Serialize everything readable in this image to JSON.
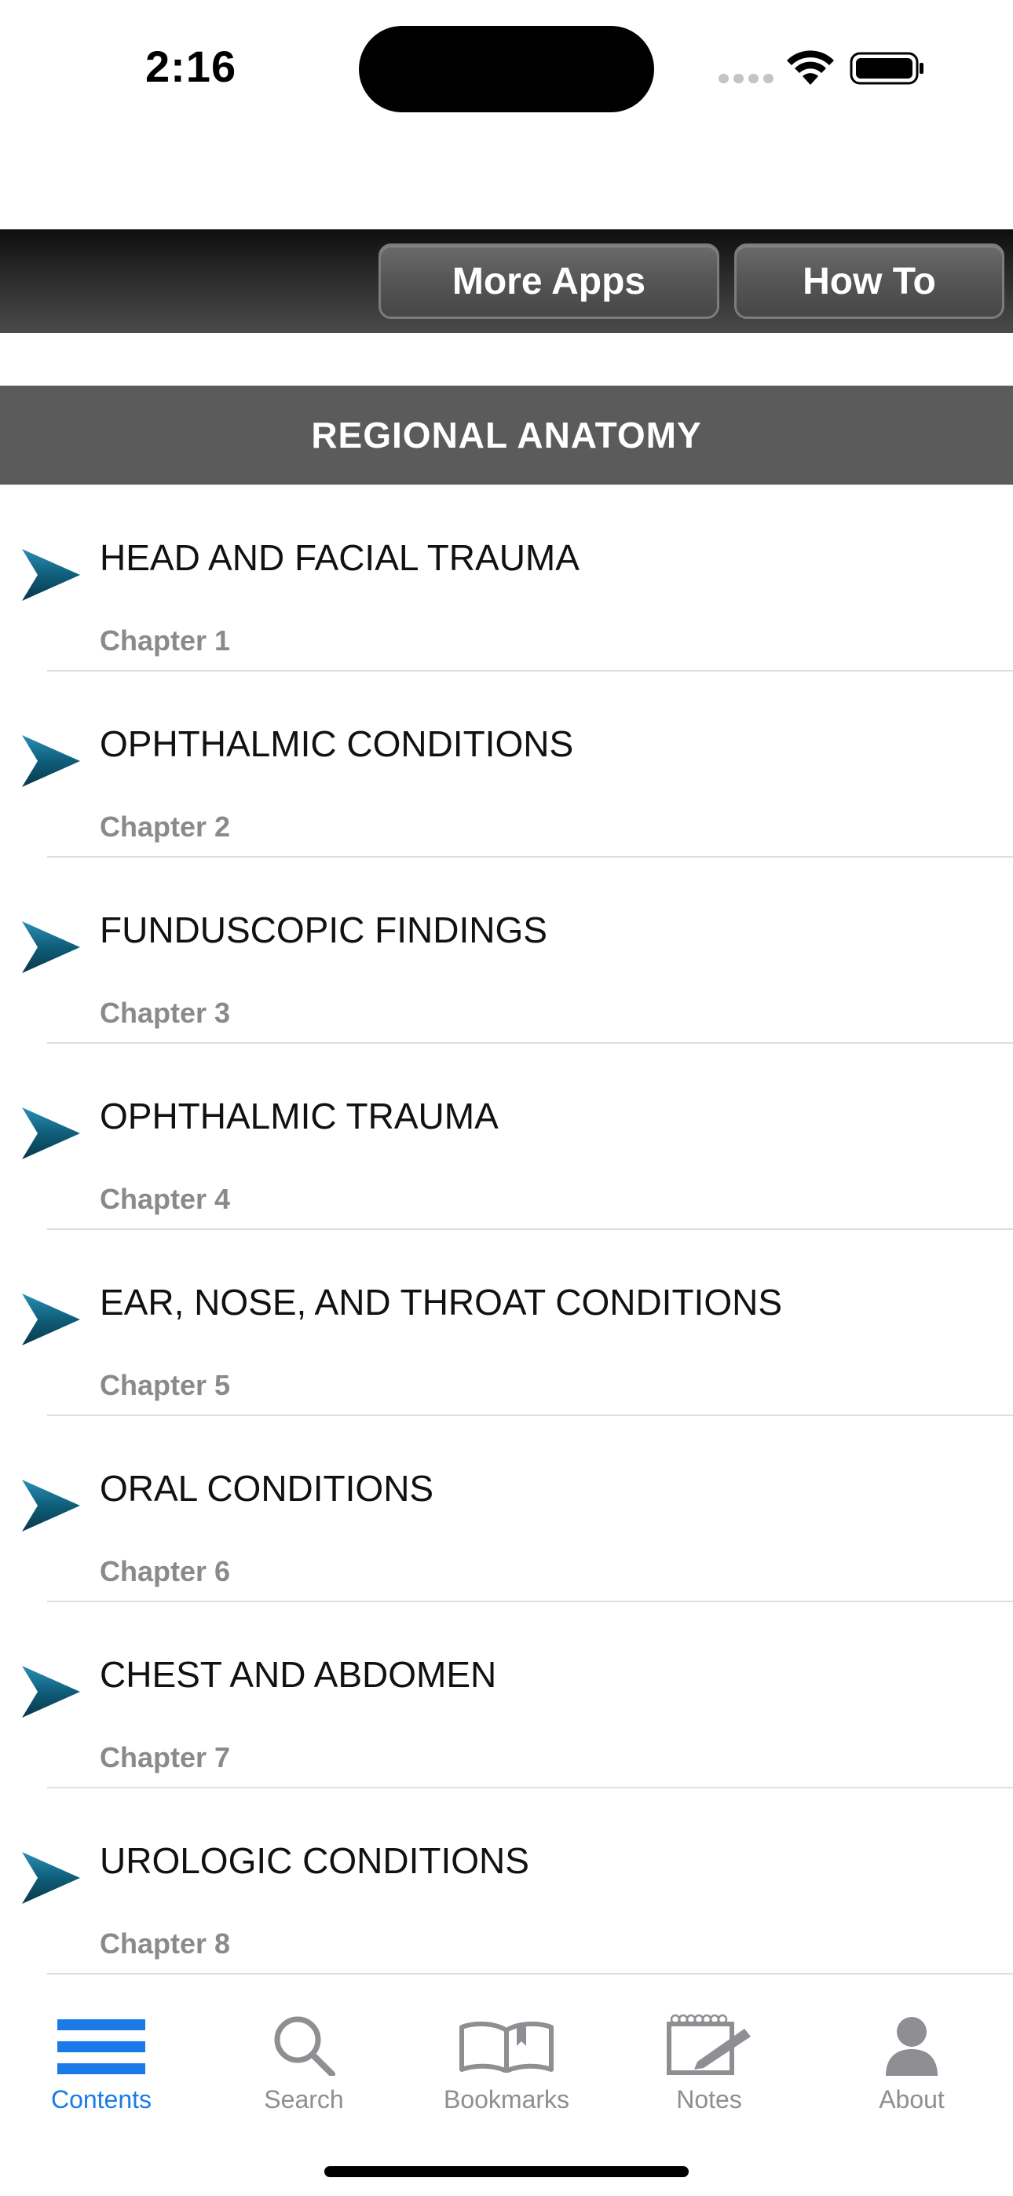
{
  "status_bar": {
    "time": "2:16"
  },
  "toolbar": {
    "more_apps_label": "More Apps",
    "how_to_label": "How To"
  },
  "section": {
    "title": "REGIONAL ANATOMY"
  },
  "chapters": [
    {
      "title": "HEAD AND FACIAL TRAUMA",
      "subtitle": "Chapter 1"
    },
    {
      "title": "OPHTHALMIC CONDITIONS",
      "subtitle": "Chapter 2"
    },
    {
      "title": "FUNDUSCOPIC FINDINGS",
      "subtitle": "Chapter 3"
    },
    {
      "title": "OPHTHALMIC TRAUMA",
      "subtitle": "Chapter 4"
    },
    {
      "title": "EAR, NOSE, AND THROAT CONDITIONS",
      "subtitle": "Chapter 5"
    },
    {
      "title": "ORAL CONDITIONS",
      "subtitle": "Chapter 6"
    },
    {
      "title": "CHEST AND ABDOMEN",
      "subtitle": "Chapter 7"
    },
    {
      "title": "UROLOGIC CONDITIONS",
      "subtitle": "Chapter 8"
    }
  ],
  "tabs": [
    {
      "label": "Contents",
      "icon": "list-icon",
      "active": true
    },
    {
      "label": "Search",
      "icon": "search-icon",
      "active": false
    },
    {
      "label": "Bookmarks",
      "icon": "book-icon",
      "active": false
    },
    {
      "label": "Notes",
      "icon": "notepad-icon",
      "active": false
    },
    {
      "label": "About",
      "icon": "person-icon",
      "active": false
    }
  ],
  "colors": {
    "accent": "#1a7be8",
    "tab_inactive": "#8e8e93",
    "section_header": "#5b5b5b",
    "arrow": "#0f5e7a"
  }
}
